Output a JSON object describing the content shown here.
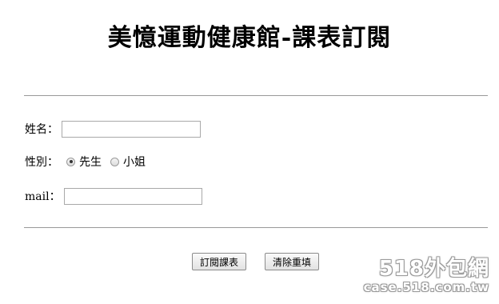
{
  "page_title": "美憶運動健康館-課表訂閱",
  "form": {
    "name_label": "姓名：",
    "name_value": "",
    "gender_label": "性別：",
    "gender_options": [
      "先生",
      "小姐"
    ],
    "gender_selected": "先生",
    "mail_label": "mail：",
    "mail_value": ""
  },
  "buttons": {
    "submit_label": "訂閱課表",
    "reset_label": "清除重填"
  },
  "watermark": {
    "main": "518外包網",
    "sub": "case.518.com.tw"
  }
}
